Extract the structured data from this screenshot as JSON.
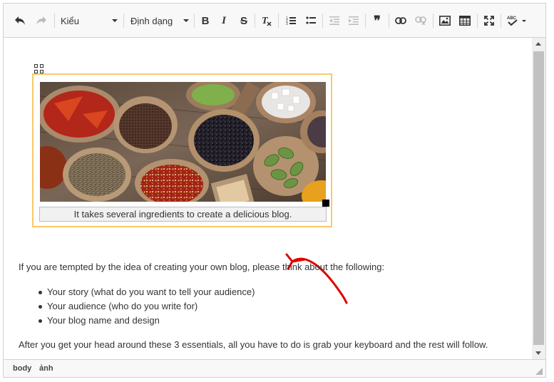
{
  "toolbar": {
    "undo_icon": "undo-arrow-icon",
    "redo_icon": "redo-arrow-icon",
    "style_combo": "Kiểu",
    "format_combo": "Định dạng",
    "bold_label": "B",
    "italic_label": "I",
    "strike_label": "S",
    "quote_label": "❞"
  },
  "content": {
    "caption": "It takes several ingredients to create a delicious blog.",
    "intro": "If you are tempted by the idea of creating your own blog, please think about the following:",
    "items": [
      "Your story (what do you want to tell your audience)",
      "Your audience (who do you write for)",
      "Your blog name and design"
    ],
    "outro": "After you get your head around these 3 essentials, all you have to do is grab your keyboard and the rest will follow."
  },
  "statusbar": {
    "path": [
      "body",
      "ảnh"
    ]
  },
  "colors": {
    "figure_border": "#f8c96a",
    "annotation_arrow": "#e00000"
  }
}
